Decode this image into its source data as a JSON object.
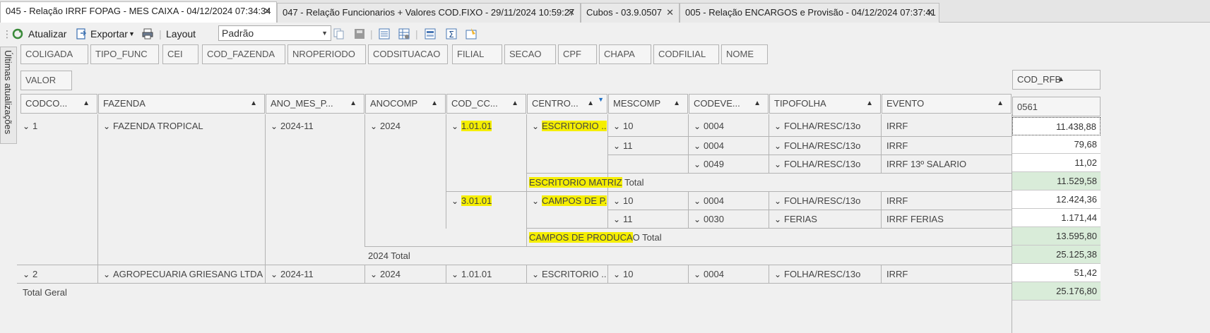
{
  "tabs": [
    {
      "label": "045 - Relação  IRRF FOPAG - MES CAIXA - 04/12/2024 07:34:34"
    },
    {
      "label": "047 - Relação Funcionarios + Valores COD.FIXO - 29/11/2024 10:59:27"
    },
    {
      "label": "Cubos - 03.9.0507"
    },
    {
      "label": "005 - Relação ENCARGOS e Provisão - 04/12/2024 07:37:41"
    }
  ],
  "toolbar": {
    "refresh_label": "Atualizar",
    "export_label": "Exportar",
    "layout_label": "Layout",
    "layout_value": "Padrão"
  },
  "side_panel": {
    "label": "Últimas atualizações"
  },
  "filter_fields": [
    "COLIGADA",
    "TIPO_FUNC",
    "CEI",
    "COD_FAZENDA",
    "NROPERIODO",
    "CODSITUACAO",
    "FILIAL",
    "SECAO",
    "CPF",
    "CHAPA",
    "CODFILIAL",
    "NOME"
  ],
  "data_field": "VALOR",
  "column_field": "COD_RFB",
  "column_value": "0561",
  "row_headers": [
    "CODCO...",
    "FAZENDA",
    "ANO_MES_P...",
    "ANOCOMP",
    "COD_CC...",
    "CENTRO...",
    "MESCOMP",
    "CODEVE...",
    "TIPOFOLHA",
    "EVENTO"
  ],
  "groups": {
    "codcoligada_1": "1",
    "fazenda_1": "FAZENDA TROPICAL",
    "anomes_1": "2024-11",
    "anocomp_1": "2024",
    "codcc_1": "1.01.01",
    "centro_1": "ESCRITORIO ...",
    "codcc_2": "3.01.01",
    "centro_2": "CAMPOS DE P...",
    "codcoligada_2": "2",
    "fazenda_2": "AGROPECUARIA GRIESANG LTDA",
    "anomes_2": "2024-11",
    "anocomp_2": "2024",
    "codcc_3": "1.01.01",
    "centro_3": "ESCRITORIO ..."
  },
  "rows": [
    {
      "mes": "10",
      "cod": "0004",
      "tipo": "FOLHA/RESC/13o",
      "evento": "IRRF",
      "valor": "11.438,88"
    },
    {
      "mes": "11",
      "cod": "0004",
      "tipo": "FOLHA/RESC/13o",
      "evento": "IRRF",
      "valor": "79,68"
    },
    {
      "mes": "",
      "cod": "0049",
      "tipo": "FOLHA/RESC/13o",
      "evento": "IRRF 13º SALARIO",
      "valor": "11,02"
    },
    {
      "mes": "10",
      "cod": "0004",
      "tipo": "FOLHA/RESC/13o",
      "evento": "IRRF",
      "valor": "12.424,36"
    },
    {
      "mes": "11",
      "cod": "0030",
      "tipo": "FERIAS",
      "evento": "IRRF FERIAS",
      "valor": "1.171,44"
    },
    {
      "mes": "10",
      "cod": "0004",
      "tipo": "FOLHA/RESC/13o",
      "evento": "IRRF",
      "valor": "51,42"
    }
  ],
  "totals": {
    "escritorio_hl": "ESCRITORIO MATRIZ",
    "escritorio_rest": " Total",
    "escritorio_value": "11.529,58",
    "campos_hl": "CAMPOS DE PRODUCA",
    "campos_rest": "O Total",
    "campos_value": "13.595,80",
    "year_label": "2024 Total",
    "year_value": "25.125,38",
    "grand_label": "Total Geral",
    "grand_value": "25.176,80"
  }
}
